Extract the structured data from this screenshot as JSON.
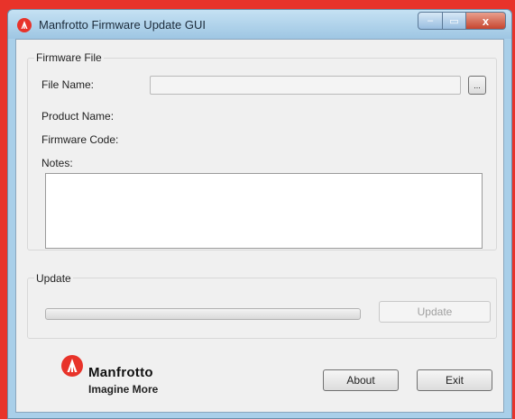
{
  "window": {
    "title": "Manfrotto Firmware Update GUI",
    "controls": {
      "minimize": "–",
      "maximize": "▭",
      "close": "x"
    }
  },
  "firmware_file": {
    "group_title": "Firmware File",
    "file_name_label": "File Name:",
    "file_name_value": "",
    "browse_label": "...",
    "product_name_label": "Product Name:",
    "product_name_value": "",
    "firmware_code_label": "Firmware Code:",
    "firmware_code_value": "",
    "notes_label": "Notes:",
    "notes_value": ""
  },
  "update": {
    "group_title": "Update",
    "progress": 0,
    "update_button_label": "Update",
    "update_button_enabled": false
  },
  "footer": {
    "brand_name": "Manfrotto",
    "brand_tagline": "Imagine More",
    "about_label": "About",
    "exit_label": "Exit"
  },
  "colors": {
    "brand_red": "#e8332a",
    "titlebar": "#a9cfe9"
  }
}
